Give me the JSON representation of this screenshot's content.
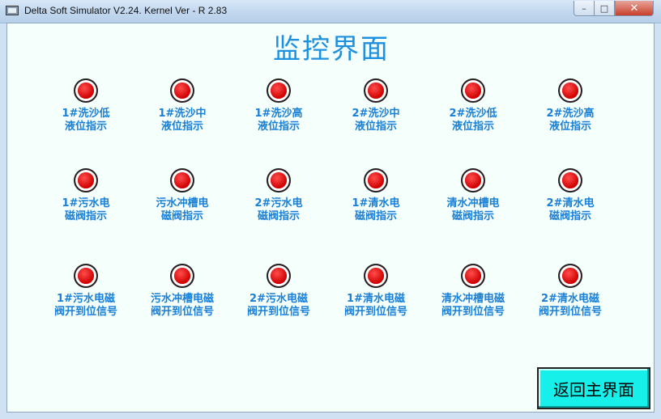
{
  "window": {
    "title": "Delta Soft Simulator V2.24. Kernel Ver - R 2.83"
  },
  "titlebar_buttons": {
    "minimize": "–",
    "maximize": "□",
    "close": "✕"
  },
  "page": {
    "title": "监控界面"
  },
  "indicators": [
    {
      "label": "1#洗沙低\n液位指示",
      "state": "off",
      "color": "#e6001d"
    },
    {
      "label": "1#洗沙中\n液位指示",
      "state": "off",
      "color": "#e6001d"
    },
    {
      "label": "1#洗沙高\n液位指示",
      "state": "off",
      "color": "#e6001d"
    },
    {
      "label": "2#洗沙中\n液位指示",
      "state": "off",
      "color": "#e6001d"
    },
    {
      "label": "2#洗沙低\n液位指示",
      "state": "off",
      "color": "#e6001d"
    },
    {
      "label": "2#洗沙高\n液位指示",
      "state": "off",
      "color": "#e6001d"
    },
    {
      "label": "1#污水电\n磁阀指示",
      "state": "off",
      "color": "#e6001d"
    },
    {
      "label": "污水冲槽电\n磁阀指示",
      "state": "off",
      "color": "#e6001d"
    },
    {
      "label": "2#污水电\n磁阀指示",
      "state": "off",
      "color": "#e6001d"
    },
    {
      "label": "1#清水电\n磁阀指示",
      "state": "off",
      "color": "#e6001d"
    },
    {
      "label": "清水冲槽电\n磁阀指示",
      "state": "off",
      "color": "#e6001d"
    },
    {
      "label": "2#清水电\n磁阀指示",
      "state": "off",
      "color": "#e6001d"
    },
    {
      "label": "1#污水电磁\n阀开到位信号",
      "state": "off",
      "color": "#e6001d"
    },
    {
      "label": "污水冲槽电磁\n阀开到位信号",
      "state": "off",
      "color": "#e6001d"
    },
    {
      "label": "2#污水电磁\n阀开到位信号",
      "state": "off",
      "color": "#e6001d"
    },
    {
      "label": "1#清水电磁\n阀开到位信号",
      "state": "off",
      "color": "#e6001d"
    },
    {
      "label": "清水冲槽电磁\n阀开到位信号",
      "state": "off",
      "color": "#e6001d"
    },
    {
      "label": "2#清水电磁\n阀开到位信号",
      "state": "off",
      "color": "#e6001d"
    }
  ],
  "return_button": {
    "label": "返回主界面",
    "color": "#17f0ea"
  }
}
